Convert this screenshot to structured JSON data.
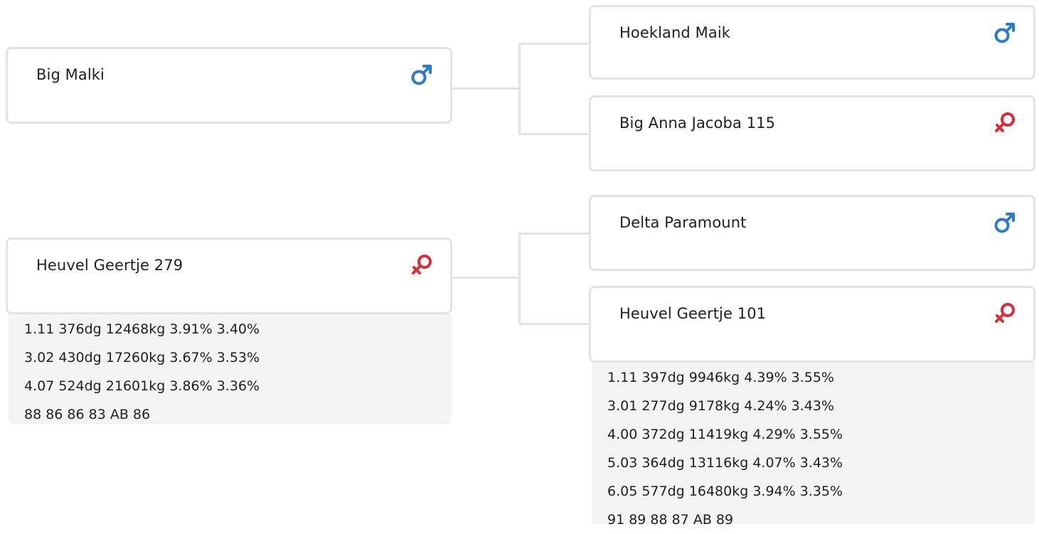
{
  "pedigree": {
    "parents": [
      {
        "name": "Big Malki",
        "sex": "male",
        "sex_icon": "male-symbol-icon",
        "parents": [
          {
            "name": "Hoekland Maik",
            "sex": "male",
            "sex_icon": "male-symbol-icon"
          },
          {
            "name": "Big Anna Jacoba 115",
            "sex": "female",
            "sex_icon": "female-symbol-icon"
          }
        ]
      },
      {
        "name": "Heuvel Geertje 279",
        "sex": "female",
        "sex_icon": "female-symbol-icon",
        "stats": [
          "1.11 376dg 12468kg 3.91% 3.40%",
          "3.02 430dg 17260kg 3.67% 3.53%",
          "4.07 524dg 21601kg 3.86% 3.36%",
          "88 86 86 83 AB 86"
        ],
        "parents": [
          {
            "name": "Delta Paramount",
            "sex": "male",
            "sex_icon": "male-symbol-icon"
          },
          {
            "name": "Heuvel Geertje 101",
            "sex": "female",
            "sex_icon": "female-symbol-icon",
            "stats": [
              "1.11 397dg 9946kg 4.39% 3.55%",
              "3.01 277dg 9178kg 4.24% 3.43%",
              "4.00 372dg 11419kg 4.29% 3.55%",
              "5.03 364dg 13116kg 4.07% 3.43%",
              "6.05 577dg 16480kg 3.94% 3.35%",
              "91 89 88 87 AB 89"
            ]
          }
        ]
      }
    ]
  },
  "colors": {
    "male": "#2f7ac6",
    "female": "#d2303a",
    "card_border": "#e3e3e3",
    "stats_bg": "#f4f4f4"
  }
}
